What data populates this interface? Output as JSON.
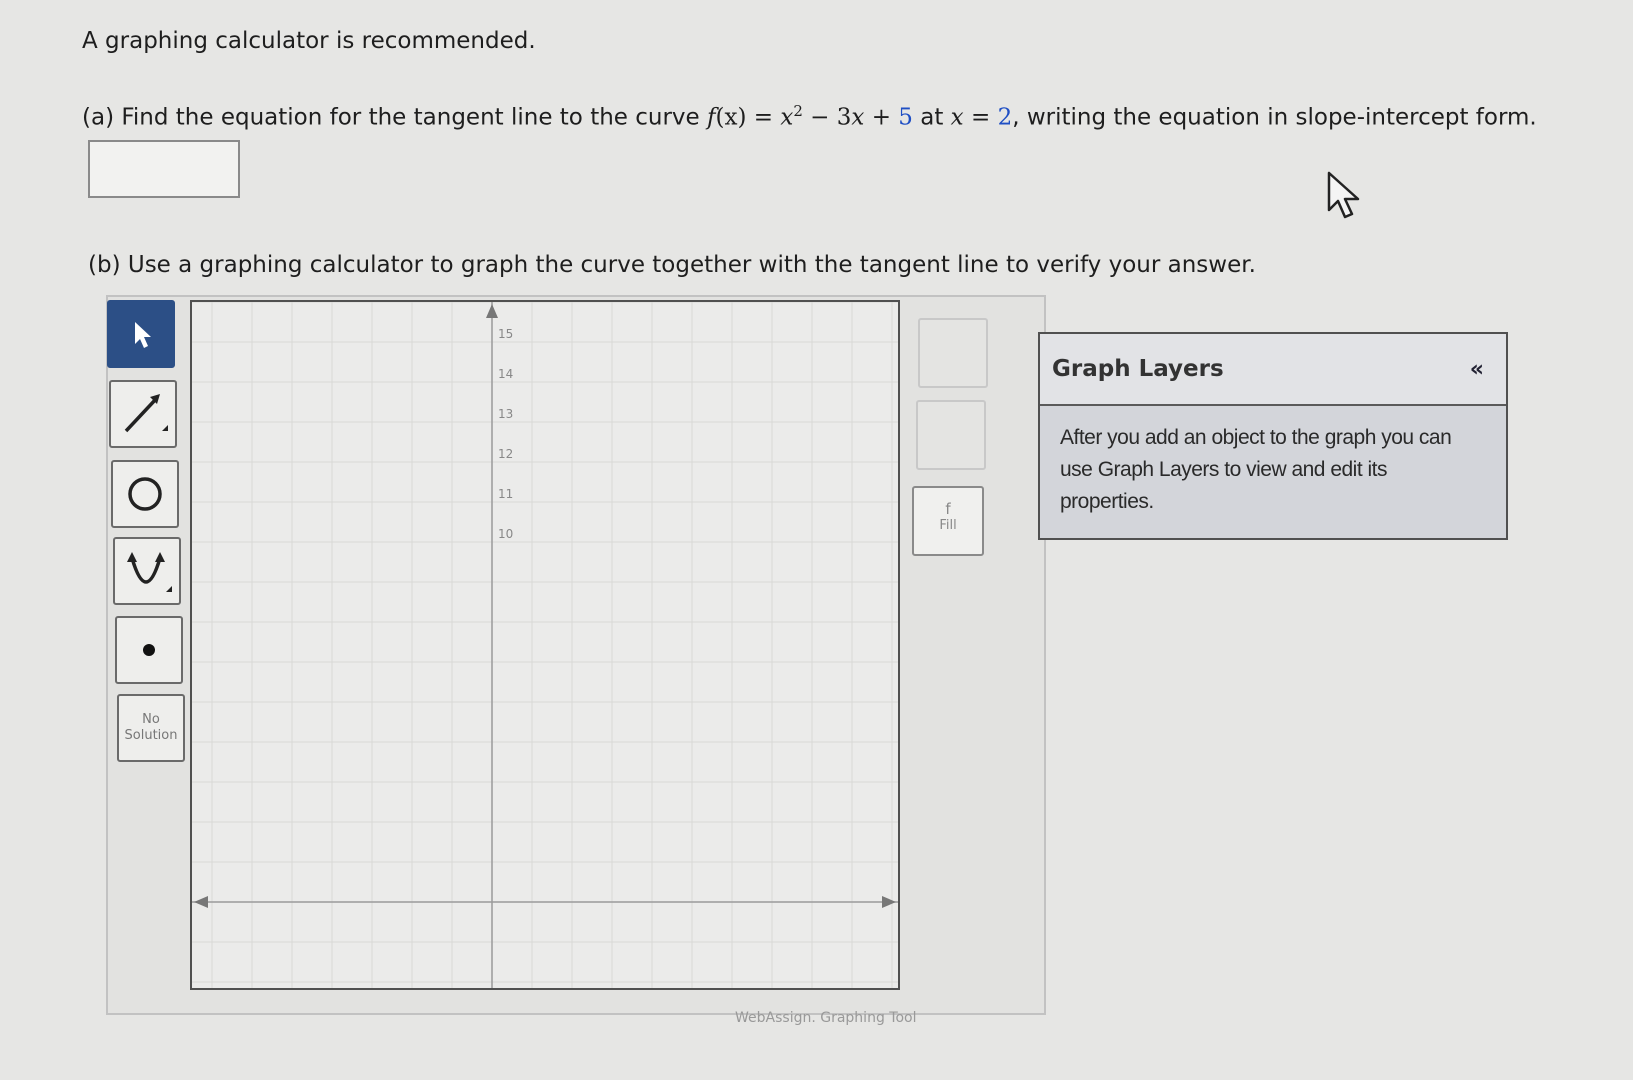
{
  "intro": "A graphing calculator is recommended.",
  "part_a": {
    "label": "(a) Find the equation for the tangent line to the curve",
    "func_name": "f",
    "func_arg": "(x)",
    "eq1": " = ",
    "t1": "x",
    "exp": "2",
    "t2": " − 3",
    "t3": "x",
    "t4": " + ",
    "const": "5",
    "at": " at ",
    "xvar": "x",
    "eq2": " = ",
    "xval": "2",
    "rest": ", writing the equation in slope-intercept form."
  },
  "part_b": {
    "text": "(b) Use a graphing calculator to graph the curve together with the tangent line to verify your answer."
  },
  "tools": {
    "no_solution_line1": "No",
    "no_solution_line2": "Solution",
    "fill_label": "Fill",
    "fill_icon_text": "f",
    "footer": "WebAssign. Graphing Tool"
  },
  "graph": {
    "y_ticks": [
      "15",
      "14",
      "13",
      "12",
      "11",
      "10"
    ]
  },
  "layers": {
    "title": "Graph Layers",
    "collapse_icon": "«",
    "body": "After you add an object to the graph you can use Graph Layers to view and edit its properties."
  }
}
